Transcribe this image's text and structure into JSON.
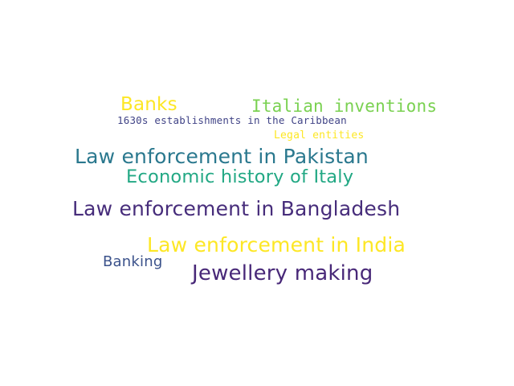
{
  "words": [
    {
      "text": "Banks",
      "color": "#fde725"
    },
    {
      "text": "Italian inventions",
      "color": "#7ad151"
    },
    {
      "text": "1630s establishments in the Caribbean",
      "color": "#414487"
    },
    {
      "text": "Legal entities",
      "color": "#fde725"
    },
    {
      "text": "Law enforcement in Pakistan",
      "color": "#2a788e"
    },
    {
      "text": "Economic history of Italy",
      "color": "#22a884"
    },
    {
      "text": "Law enforcement in Bangladesh",
      "color": "#472d7b"
    },
    {
      "text": "Law enforcement in India",
      "color": "#fde725"
    },
    {
      "text": "Banking",
      "color": "#3b528b"
    },
    {
      "text": "Jewellery making",
      "color": "#482878"
    }
  ]
}
